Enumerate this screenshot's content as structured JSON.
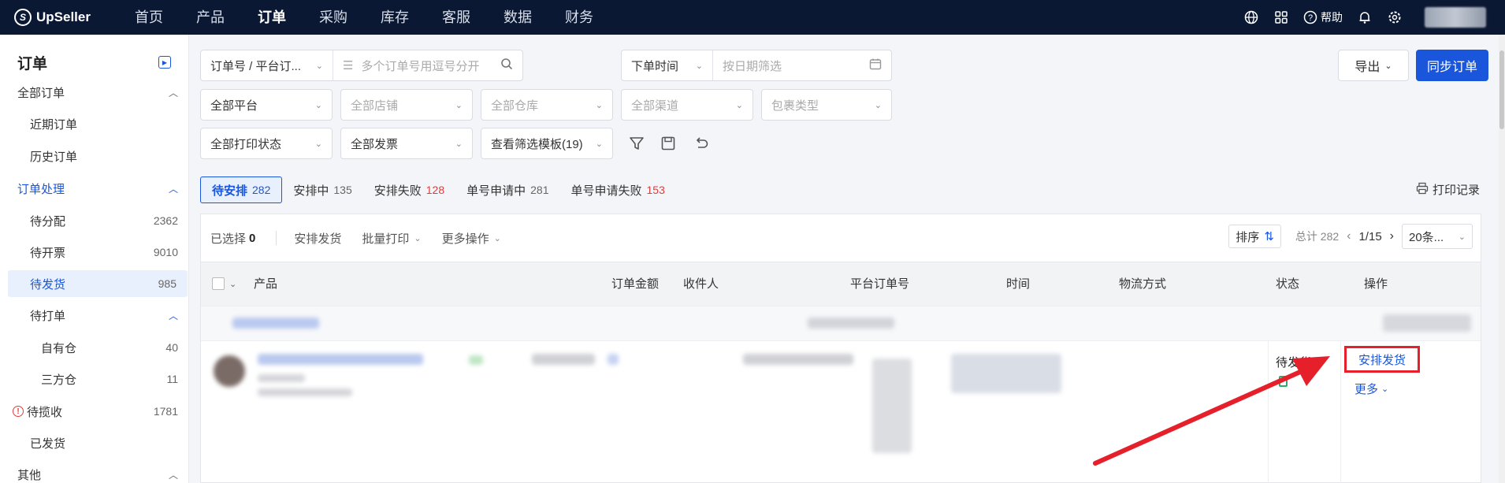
{
  "app": {
    "logo_text": "UpSeller"
  },
  "nav": {
    "items": [
      "首页",
      "产品",
      "订单",
      "采购",
      "库存",
      "客服",
      "数据",
      "财务"
    ],
    "active_index": 2
  },
  "top_right": {
    "help_label": "帮助"
  },
  "sidebar": {
    "title": "订单",
    "all_orders": "全部订单",
    "recent_orders": "近期订单",
    "history_orders": "历史订单",
    "processing": "订单处理",
    "pending_assign": {
      "label": "待分配",
      "count": "2362"
    },
    "pending_invoice": {
      "label": "待开票",
      "count": "9010"
    },
    "pending_ship": {
      "label": "待发货",
      "count": "985"
    },
    "pending_print": {
      "label": "待打单"
    },
    "own_wh": {
      "label": "自有仓",
      "count": "40"
    },
    "third_wh": {
      "label": "三方仓",
      "count": "11"
    },
    "pending_pickup": {
      "label": "待揽收",
      "count": "1781"
    },
    "shipped": {
      "label": "已发货"
    },
    "other": "其他"
  },
  "filters": {
    "order_no_type": "订单号 / 平台订...",
    "order_no_placeholder": "多个订单号用逗号分开",
    "time_type": "下单时间",
    "date_placeholder": "按日期筛选",
    "platform": "全部平台",
    "shop": "全部店铺",
    "warehouse": "全部仓库",
    "channel": "全部渠道",
    "package_type": "包裹类型",
    "print_status": "全部打印状态",
    "invoice": "全部发票",
    "template": "查看筛选模板(19)"
  },
  "actions": {
    "export": "导出",
    "sync": "同步订单"
  },
  "tabs": [
    {
      "label": "待安排",
      "count": "282"
    },
    {
      "label": "安排中",
      "count": "135"
    },
    {
      "label": "安排失败",
      "count": "128"
    },
    {
      "label": "单号申请中",
      "count": "281"
    },
    {
      "label": "单号申请失败",
      "count": "153"
    }
  ],
  "print_log": "打印记录",
  "toolbar": {
    "selected_label": "已选择",
    "selected_count": "0",
    "arrange_ship": "安排发货",
    "batch_print": "批量打印",
    "more_ops": "更多操作",
    "sort": "排序",
    "total": "总计 282",
    "page": "1/15",
    "page_size": "20条..."
  },
  "table": {
    "columns": [
      "产品",
      "订单金额",
      "收件人",
      "平台订单号",
      "时间",
      "物流方式",
      "状态",
      "操作"
    ]
  },
  "order_row": {
    "status": "待发货",
    "action_primary": "安排发货",
    "action_more": "更多"
  },
  "colors": {
    "brand": "#1a56db",
    "topbar": "#0b1833",
    "highlight": "#e5202a"
  }
}
